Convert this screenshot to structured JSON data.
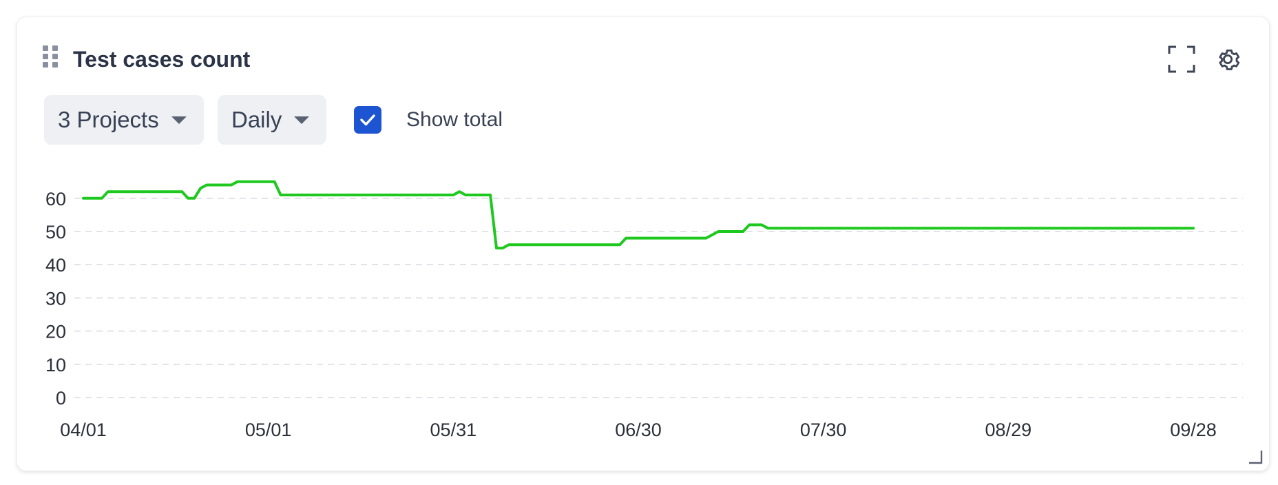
{
  "widget": {
    "title": "Test cases count",
    "icons": {
      "drag": "drag-handle-icon",
      "fullscreen": "fullscreen-icon",
      "settings": "gear-icon",
      "resize": "resize-grip-icon"
    }
  },
  "filters": {
    "projects_label": "3 Projects",
    "interval_label": "Daily",
    "show_total_label": "Show total",
    "show_total_checked": true
  },
  "colors": {
    "line": "#1ec81e",
    "checkbox": "#1d54d1",
    "title": "#2b3346"
  },
  "chart_data": {
    "type": "line",
    "title": "",
    "xlabel": "",
    "ylabel": "",
    "ylim": [
      0,
      65
    ],
    "y_ticks": [
      0,
      10,
      20,
      30,
      40,
      50,
      60
    ],
    "x_tick_labels": [
      "04/01",
      "05/01",
      "05/31",
      "06/30",
      "07/30",
      "08/29",
      "09/28"
    ],
    "grid": true,
    "x_start_date": "04/01",
    "series": [
      {
        "name": "",
        "color": "#1ec81e",
        "points": [
          [
            0,
            60
          ],
          [
            3,
            60
          ],
          [
            4,
            62
          ],
          [
            16,
            62
          ],
          [
            17,
            60
          ],
          [
            18,
            60
          ],
          [
            19,
            63
          ],
          [
            20,
            64
          ],
          [
            24,
            64
          ],
          [
            25,
            65
          ],
          [
            31,
            65
          ],
          [
            32,
            61
          ],
          [
            60,
            61
          ],
          [
            61,
            62
          ],
          [
            62,
            61
          ],
          [
            66,
            61
          ],
          [
            67,
            45
          ],
          [
            68,
            45
          ],
          [
            69,
            46
          ],
          [
            87,
            46
          ],
          [
            88,
            48
          ],
          [
            101,
            48
          ],
          [
            103,
            50
          ],
          [
            107,
            50
          ],
          [
            108,
            52
          ],
          [
            110,
            52
          ],
          [
            111,
            51
          ],
          [
            180,
            51
          ]
        ]
      }
    ]
  }
}
